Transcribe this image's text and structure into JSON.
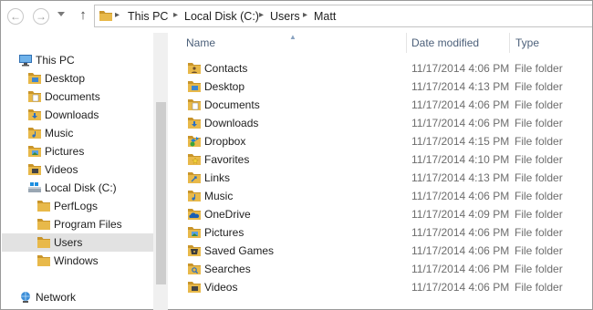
{
  "address_bar": {
    "crumbs": [
      "This PC",
      "Local Disk (C:)",
      "Users",
      "Matt"
    ]
  },
  "nav_pane": {
    "items": [
      {
        "label": "This PC",
        "icon": "computer-icon"
      },
      {
        "label": "Desktop",
        "icon": "folder-icon"
      },
      {
        "label": "Documents",
        "icon": "folder-icon"
      },
      {
        "label": "Downloads",
        "icon": "folder-icon"
      },
      {
        "label": "Music",
        "icon": "folder-icon"
      },
      {
        "label": "Pictures",
        "icon": "folder-icon"
      },
      {
        "label": "Videos",
        "icon": "folder-icon"
      },
      {
        "label": "Local Disk (C:)",
        "icon": "drive-icon"
      },
      {
        "label": "PerfLogs",
        "icon": "folder-icon"
      },
      {
        "label": "Program Files",
        "icon": "folder-icon"
      },
      {
        "label": "Users",
        "icon": "folder-icon",
        "selected": true
      },
      {
        "label": "Windows",
        "icon": "folder-icon"
      },
      {
        "label": "Network",
        "icon": "network-icon"
      }
    ]
  },
  "columns": {
    "name": "Name",
    "date_modified": "Date modified",
    "type": "Type"
  },
  "files": [
    {
      "name": "Contacts",
      "date": "11/17/2014 4:06 PM",
      "type": "File folder",
      "icon": "contacts-folder-icon"
    },
    {
      "name": "Desktop",
      "date": "11/17/2014 4:13 PM",
      "type": "File folder",
      "icon": "desktop-folder-icon"
    },
    {
      "name": "Documents",
      "date": "11/17/2014 4:06 PM",
      "type": "File folder",
      "icon": "documents-folder-icon"
    },
    {
      "name": "Downloads",
      "date": "11/17/2014 4:06 PM",
      "type": "File folder",
      "icon": "downloads-folder-icon"
    },
    {
      "name": "Dropbox",
      "date": "11/17/2014 4:15 PM",
      "type": "File folder",
      "icon": "dropbox-folder-icon"
    },
    {
      "name": "Favorites",
      "date": "11/17/2014 4:10 PM",
      "type": "File folder",
      "icon": "favorites-folder-icon"
    },
    {
      "name": "Links",
      "date": "11/17/2014 4:13 PM",
      "type": "File folder",
      "icon": "links-folder-icon"
    },
    {
      "name": "Music",
      "date": "11/17/2014 4:06 PM",
      "type": "File folder",
      "icon": "music-folder-icon"
    },
    {
      "name": "OneDrive",
      "date": "11/17/2014 4:09 PM",
      "type": "File folder",
      "icon": "onedrive-folder-icon"
    },
    {
      "name": "Pictures",
      "date": "11/17/2014 4:06 PM",
      "type": "File folder",
      "icon": "pictures-folder-icon"
    },
    {
      "name": "Saved Games",
      "date": "11/17/2014 4:06 PM",
      "type": "File folder",
      "icon": "saved-games-folder-icon"
    },
    {
      "name": "Searches",
      "date": "11/17/2014 4:06 PM",
      "type": "File folder",
      "icon": "searches-folder-icon"
    },
    {
      "name": "Videos",
      "date": "11/17/2014 4:06 PM",
      "type": "File folder",
      "icon": "videos-folder-icon"
    }
  ],
  "colors": {
    "folder": "#e8b94a",
    "folder_dark": "#c9952a",
    "header_text": "#4c607a",
    "selected_bg": "#e2e2e2"
  }
}
